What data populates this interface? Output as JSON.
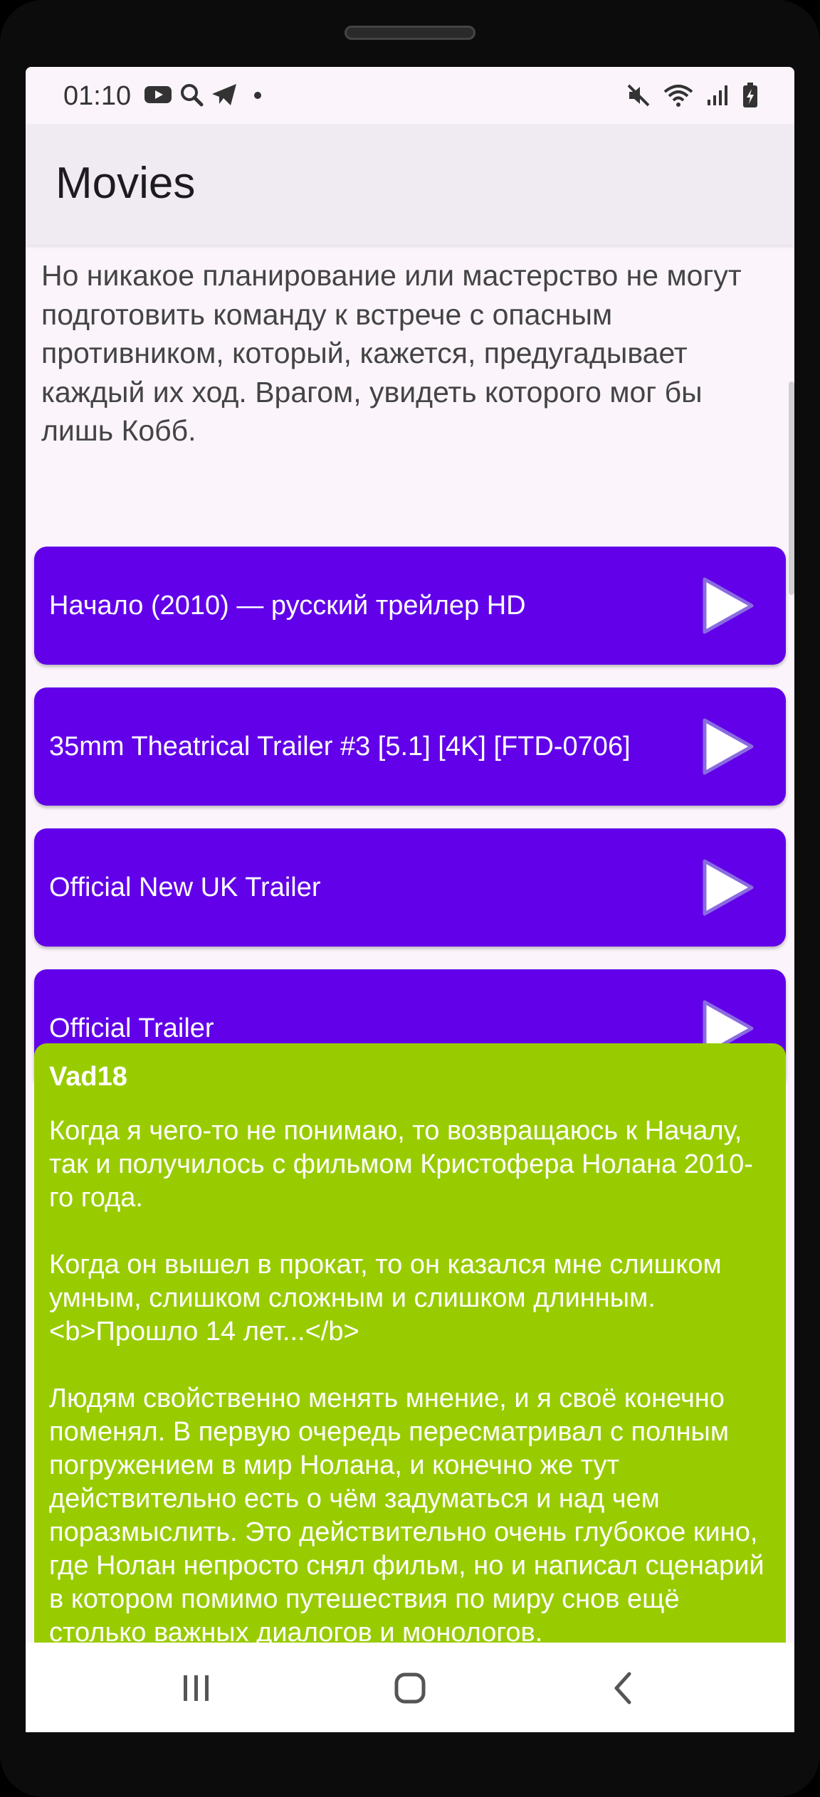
{
  "status_bar": {
    "time": "01:10",
    "left_icons": [
      "youtube-icon",
      "search-icon",
      "telegram-icon",
      "dot-icon"
    ],
    "right_icons": [
      "mute-icon",
      "wifi-icon",
      "signal-icon",
      "battery-icon"
    ]
  },
  "app_bar": {
    "title": "Movies"
  },
  "description": "Но никакое планирование или мастерство не могут подготовить команду к встрече с опасным противником, который, кажется, предугадывает каждый их ход. Врагом, увидеть которого мог бы лишь Кобб.",
  "trailers": [
    {
      "label": "Начало (2010) — русский трейлер HD"
    },
    {
      "label": "35mm Theatrical Trailer #3 [5.1] [4K] [FTD-0706]"
    },
    {
      "label": "Official New UK Trailer"
    },
    {
      "label": "Official Trailer"
    }
  ],
  "review": {
    "author": "Vad18",
    "text": "Когда я чего-то не понимаю, то возвращаюсь к Началу, так и получилось с фильмом Кристофера Нолана 2010-го года.\n\nКогда он вышел в прокат, то он казался мне слишком умным, слишком сложным и слишком длинным. <b>Прошло 14 лет...</b>\n\nЛюдям свойственно менять мнение, и я своё конечно поменял. В первую очередь пересматривал с полным погружением в мир Нолана, и конечно же тут действительно есть о чём задуматься и над чем поразмыслить. Это действительно очень глубокое кино, где Нолан непросто снял фильм, но и написал сценарий в котором помимо путешествия по миру снов ещё столько важных диалогов и монологов."
  },
  "colors": {
    "trailer_button": "#6200ea",
    "review_card": "#99cc00",
    "background": "#fbf5fb",
    "app_bar": "#f0ebf2"
  },
  "nav_bar": {
    "buttons": [
      "recents-icon",
      "home-icon",
      "back-icon"
    ]
  }
}
